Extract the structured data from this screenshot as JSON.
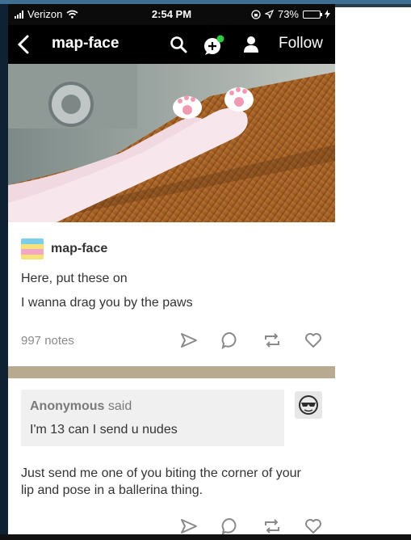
{
  "status_bar": {
    "carrier": "Verizon",
    "time": "2:54 PM",
    "battery_percent": "73%",
    "battery_level": 0.73,
    "battery_color": "#f5c400"
  },
  "nav": {
    "title": "map-face",
    "follow_label": "Follow",
    "icons": [
      "back-chevron-icon",
      "search-icon",
      "chat-bubble-icon",
      "user-icon"
    ]
  },
  "post": {
    "author": "map-face",
    "lines": [
      "Here, put these on",
      "I wanna drag you by the paws"
    ],
    "notes": "997 notes",
    "actions": [
      "share-icon",
      "reply-icon",
      "reblog-icon",
      "like-icon"
    ]
  },
  "ask": {
    "asker": "Anonymous",
    "said": "said",
    "question": "I'm 13 can I send u nudes",
    "answer": "Just send me one of you biting the corner of your lip and pose in a ballerina thing."
  },
  "colors": {
    "nav_bg": "#000000",
    "divider_band": "#b7aa90",
    "ask_bg": "#f0f0f0",
    "online_dot": "#2ecc40"
  }
}
